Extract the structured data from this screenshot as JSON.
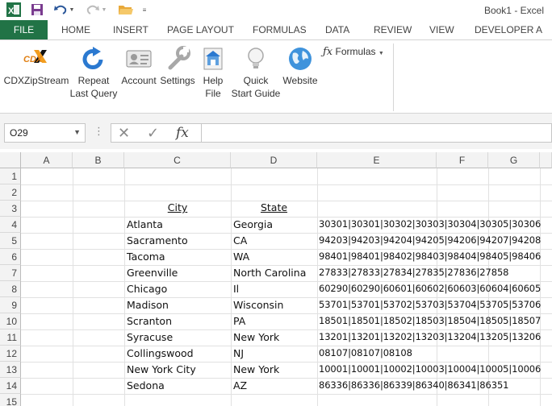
{
  "window": {
    "title": "Book1 - Excel"
  },
  "quick_access": {
    "items": [
      "excel-logo-icon",
      "save-icon",
      "undo-icon",
      "undo-dropdown-icon",
      "redo-icon",
      "redo-dropdown-icon",
      "open-folder-icon",
      "customize-qat-icon"
    ]
  },
  "tabs": {
    "file": "FILE",
    "items": [
      "HOME",
      "INSERT",
      "PAGE LAYOUT",
      "FORMULAS",
      "DATA",
      "REVIEW",
      "VIEW",
      "DEVELOPER",
      "A"
    ]
  },
  "ribbon": {
    "buttons": [
      {
        "label": "CDXZipStream",
        "icon": "cdx-logo-icon"
      },
      {
        "label": "Repeat\nLast Query",
        "icon": "refresh-arrow-icon"
      },
      {
        "label": "Account",
        "icon": "account-card-icon"
      },
      {
        "label": "Settings",
        "icon": "wrench-icon"
      },
      {
        "label": "Help\nFile",
        "icon": "help-file-icon"
      },
      {
        "label": "Quick\nStart Guide",
        "icon": "lightbulb-icon"
      },
      {
        "label": "Website",
        "icon": "globe-icon"
      }
    ],
    "formulas_dropdown": {
      "label": "Formulas",
      "icon": "fx-icon"
    },
    "cdx_logo_text": "CDX"
  },
  "formula_bar": {
    "name_box": "O29",
    "fx": "fx",
    "value": ""
  },
  "sheet": {
    "columns": [
      "A",
      "B",
      "C",
      "D",
      "E",
      "F",
      "G"
    ],
    "rows": [
      "1",
      "2",
      "3",
      "4",
      "5",
      "6",
      "7",
      "8",
      "9",
      "10",
      "11",
      "12",
      "13",
      "14",
      "15"
    ],
    "headers": {
      "city": "City",
      "state": "State"
    },
    "data": [
      {
        "city": "Atlanta",
        "state": "Georgia",
        "zips": "30301|30301|30302|30303|30304|30305|30306"
      },
      {
        "city": "Sacramento",
        "state": "CA",
        "zips": "94203|94203|94204|94205|94206|94207|94208"
      },
      {
        "city": "Tacoma",
        "state": "WA",
        "zips": "98401|98401|98402|98403|98404|98405|98406"
      },
      {
        "city": "Greenville",
        "state": "North Carolina",
        "zips": "27833|27833|27834|27835|27836|27858"
      },
      {
        "city": "Chicago",
        "state": "Il",
        "zips": "60290|60290|60601|60602|60603|60604|60605"
      },
      {
        "city": "Madison",
        "state": "Wisconsin",
        "zips": "53701|53701|53702|53703|53704|53705|53706"
      },
      {
        "city": "Scranton",
        "state": "PA",
        "zips": "18501|18501|18502|18503|18504|18505|18507"
      },
      {
        "city": "Syracuse",
        "state": "New York",
        "zips": "13201|13201|13202|13203|13204|13205|13206"
      },
      {
        "city": "Collingswood",
        "state": "NJ",
        "zips": "08107|08107|08108"
      },
      {
        "city": "New York City",
        "state": "New York",
        "zips": "10001|10001|10002|10003|10004|10005|10006"
      },
      {
        "city": "Sedona",
        "state": "AZ",
        "zips": "86336|86336|86339|86340|86341|86351"
      }
    ]
  },
  "colors": {
    "file_tab": "#217346",
    "accent_blue": "#2b79d0"
  }
}
